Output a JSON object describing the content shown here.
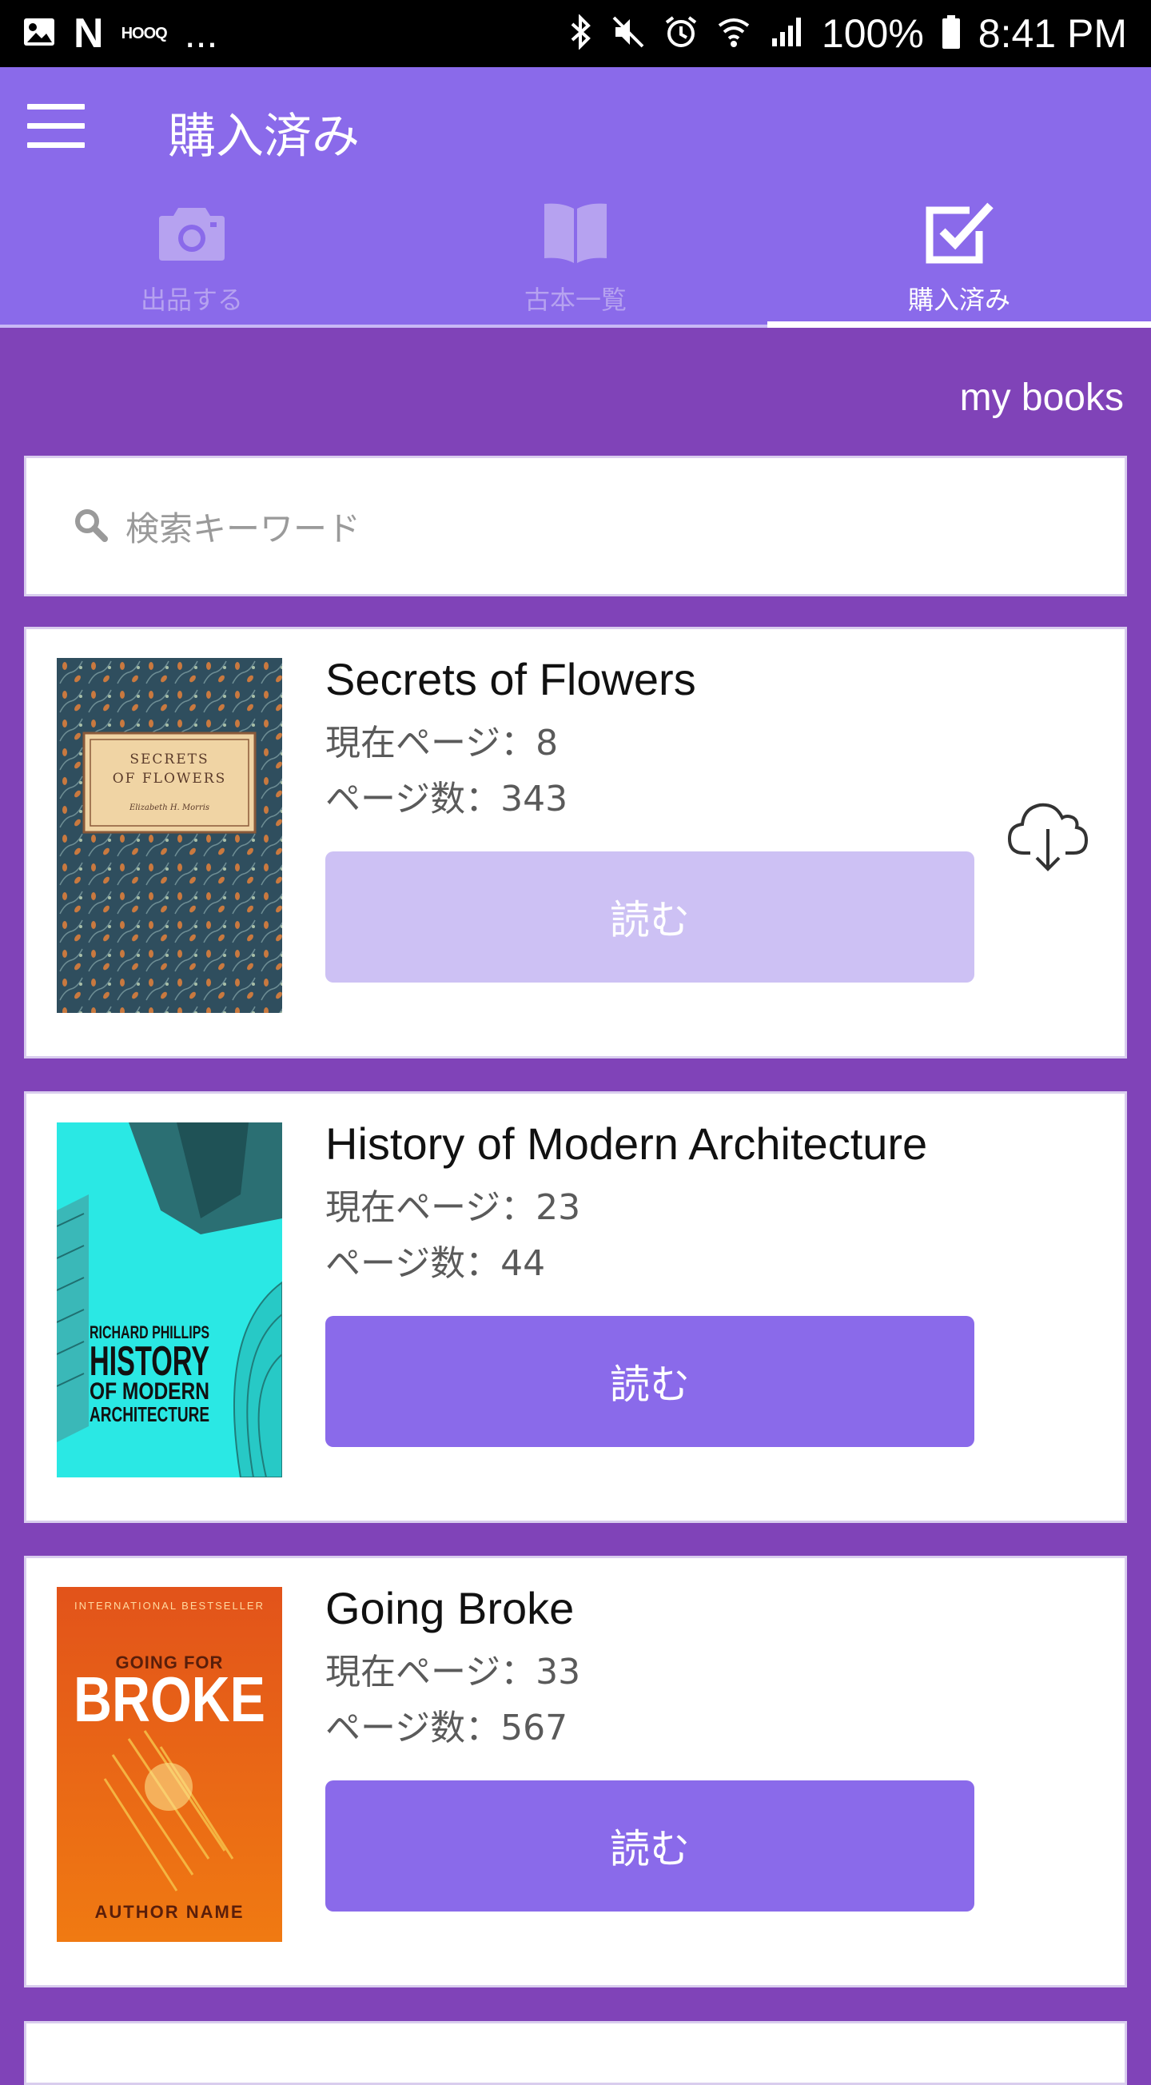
{
  "status_bar": {
    "left_small": "HOOQ",
    "left_dots": "...",
    "battery": "100%",
    "time": "8:41 PM"
  },
  "app_bar": {
    "title": "購入済み",
    "tabs": [
      {
        "label": "出品する",
        "icon": "camera-icon"
      },
      {
        "label": "古本一覧",
        "icon": "book-icon"
      },
      {
        "label": "購入済み",
        "icon": "checkbox-icon",
        "active": true
      }
    ]
  },
  "main": {
    "section_label": "my books",
    "search": {
      "placeholder": "検索キーワード"
    },
    "books": [
      {
        "title": "Secrets of Flowers",
        "current_page": "現在ページ：8",
        "page_count": "ページ数：343",
        "read_label": "読む",
        "cover_line1": "SECRETS",
        "cover_line2": "OF FLOWERS",
        "cover_author": "Elizabeth H. Morris",
        "downloadable": true
      },
      {
        "title": "History of Modern Architecture",
        "current_page": "現在ページ：23",
        "page_count": "ページ数：44",
        "read_label": "読む",
        "cover_author": "RICHARD PHILLIPS",
        "cover_line1": "HISTORY",
        "cover_line2": "OF MODERN",
        "cover_line3": "ARCHITECTURE"
      },
      {
        "title": "Going Broke",
        "current_page": "現在ページ：33",
        "page_count": "ページ数：567",
        "read_label": "読む",
        "cover_top": "INTERNATIONAL BESTSELLER",
        "cover_line1": "GOING FOR",
        "cover_line2": "BROKE",
        "cover_author": "AUTHOR NAME"
      }
    ]
  },
  "colors": {
    "app_bar": "#8a6aea",
    "background": "#8043b8",
    "button": "#8a6aea",
    "button_disabled": "#cdc1f4"
  }
}
